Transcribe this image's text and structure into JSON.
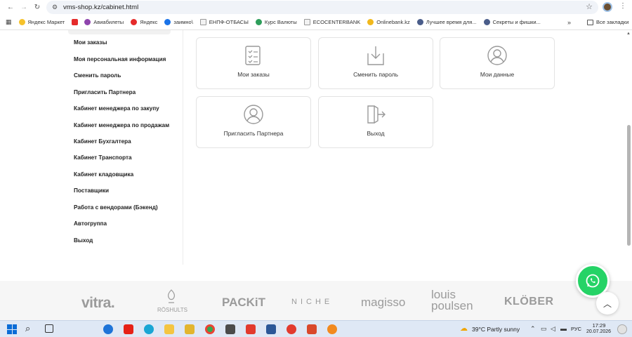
{
  "browser": {
    "url": "vms-shop.kz/cabinet.html",
    "bookmarks": [
      "Яндекс Маркет",
      "Авиабилеты",
      "Яндекс",
      "заимно\\",
      "ЕНПФ-ОТБАСЫ",
      "Курс Валюты",
      "ECOCENTERBANK",
      "Onlinebank.kz",
      "Лучшее время для...",
      "Секреты и фишки..."
    ],
    "all_bookmarks": "Все закладки"
  },
  "sidebar": {
    "items": [
      "Мои заказы",
      "Моя персональная информация",
      "Сменить пароль",
      "Пригласить Партнера",
      "Кабинет менеджера по закупу",
      "Кабинет менеджера по продажам",
      "Кабинет Бухгалтера",
      "Кабинет Транспорта",
      "Кабинет кладовщика",
      "Поставщики",
      "Работа с вендорами (Бэкенд)",
      "Автогруппа",
      "Выход"
    ]
  },
  "cards": [
    {
      "label": "Мои заказы",
      "icon": "clipboard-list-icon"
    },
    {
      "label": "Сменить пароль",
      "icon": "download-box-icon"
    },
    {
      "label": "Мои данные",
      "icon": "user-circle-icon"
    },
    {
      "label": "Пригласить Партнера",
      "icon": "user-circle-icon"
    },
    {
      "label": "Выход",
      "icon": "exit-door-icon"
    }
  ],
  "brands": [
    "vitra.",
    "RÖSHULTS",
    "PACKiT",
    "NICHE",
    "magisso",
    "louis\npoulsen",
    "KLÖBER"
  ],
  "taskbar": {
    "weather": "39°C  Partly sunny",
    "lang": "РУС",
    "time": "17:29",
    "date": "20.07.2026"
  },
  "colors": {
    "whatsapp": "#25d366",
    "taskbar": "#dfe8f5",
    "brand_text": "#9b9b9b"
  }
}
